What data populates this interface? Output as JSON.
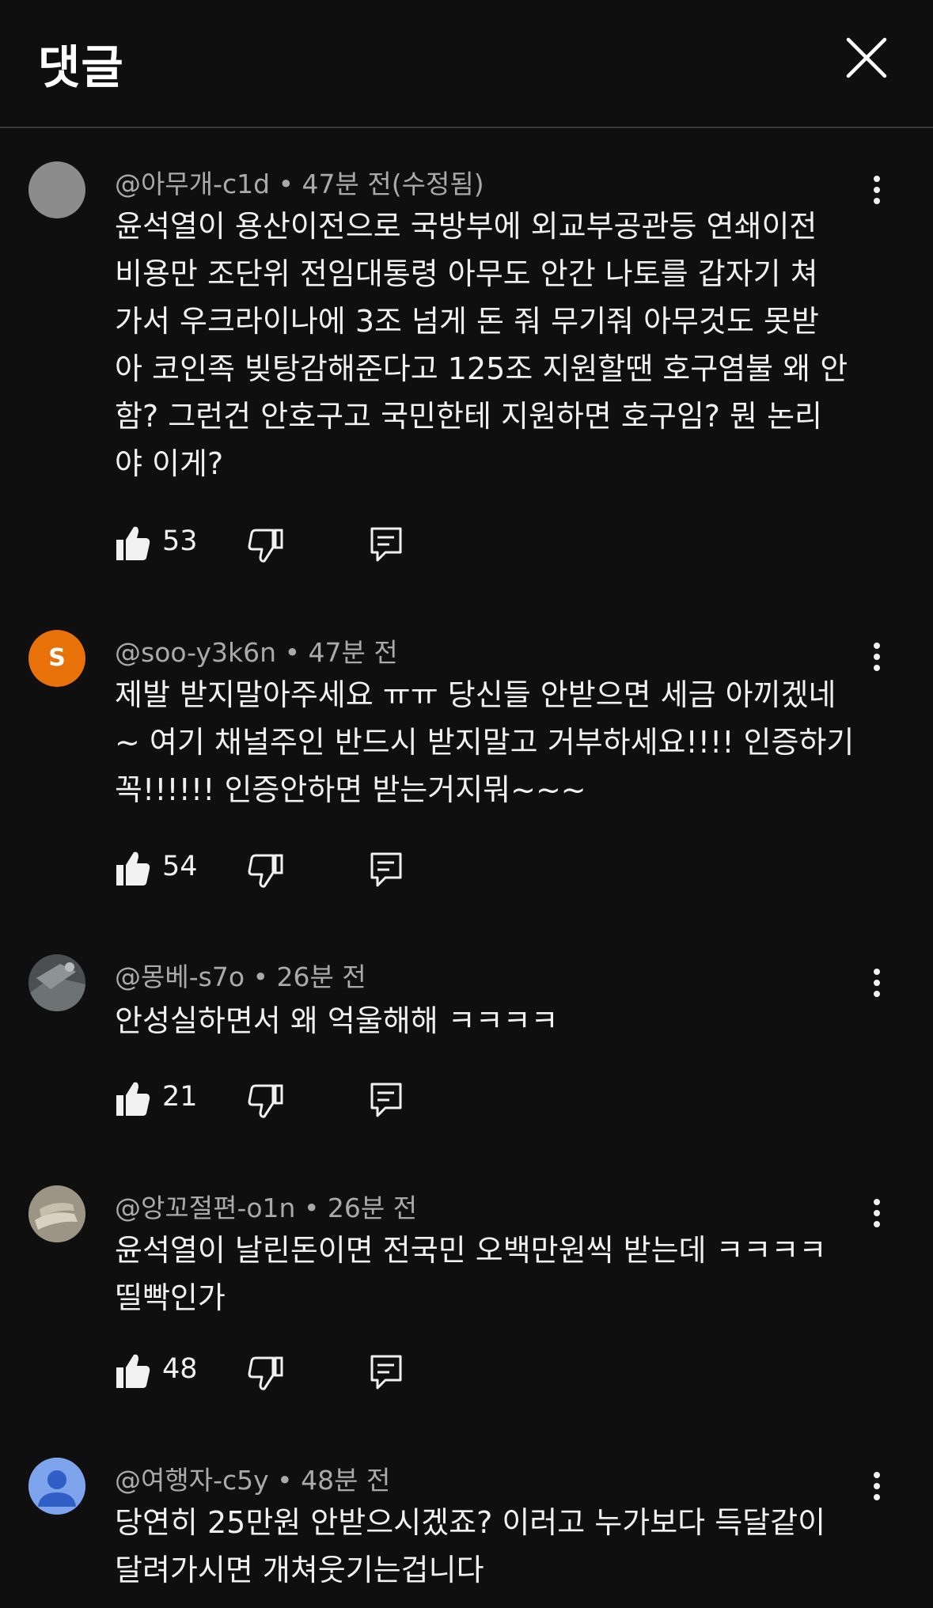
{
  "header": {
    "title": "댓글"
  },
  "comments": [
    {
      "author": "@아무개-c1d",
      "time": "47분 전(수정됨)",
      "text": "윤석열이 용산이전으로 국방부에 외교부공관등 연쇄이전\n비용만 조단위 전임대통령 아무도 안간 나토를 갑자기 쳐\n가서 우크라이나에 3조 넘게 돈 줘 무기줘 아무것도 못받\n아 코인족 빚탕감해준다고 125조 지원할땐 호구염불 왜 안\n함? 그런건 안호구고 국민한테 지원하면 호구임? 뭔 논리\n야 이게?",
      "likes": "53",
      "avatar": {
        "type": "plain",
        "color": "#8a8a8a"
      }
    },
    {
      "author": "@soo-y3k6n",
      "time": "47분 전",
      "text": "제발 받지말아주세요 ㅠㅠ 당신들 안받으면 세금 아끼겠네\n~ 여기 채널주인 반드시 받지말고 거부하세요!!!! 인증하기\n꼭!!!!!! 인증안하면 받는거지뭐~~~",
      "likes": "54",
      "avatar": {
        "type": "letter",
        "letter": "S",
        "color": "#e8710a"
      }
    },
    {
      "author": "@몽베-s7o",
      "time": "26분 전",
      "text": "안성실하면서 왜 억울해해 ㅋㅋㅋㅋ",
      "likes": "21",
      "avatar": {
        "type": "photo",
        "color": "#5a5e60"
      }
    },
    {
      "author": "@앙꼬절편-o1n",
      "time": "26분 전",
      "text": "윤석열이 날린돈이면 전국민 오백만원씩 받는데 ㅋㅋㅋㅋ\n띨빡인가",
      "likes": "48",
      "avatar": {
        "type": "photo",
        "color": "#a39b8c"
      }
    },
    {
      "author": "@여행자-c5y",
      "time": "48분 전",
      "text": "당연히 25만원 안받으시겠죠? 이러고 누가보다 득달같이\n달려가시면 개쳐웃기는겁니다",
      "likes": "",
      "avatar": {
        "type": "person",
        "color": "#7ba3f0"
      }
    }
  ],
  "icons": {
    "close": "close-icon",
    "more": "more-vert-icon",
    "like": "thumb-up-icon",
    "dislike": "thumb-down-icon",
    "reply": "reply-icon"
  }
}
